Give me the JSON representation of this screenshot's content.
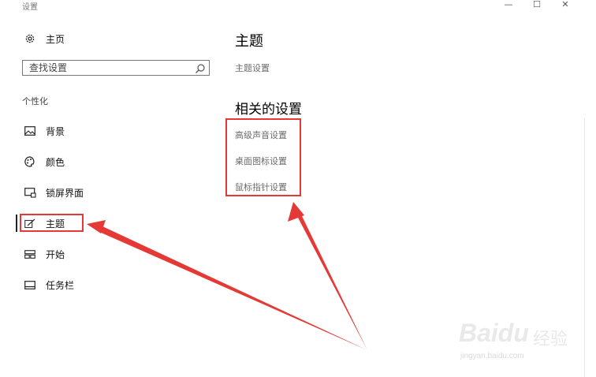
{
  "window": {
    "title": "设置",
    "minimize_glyph": "—",
    "maximize_glyph": "☐",
    "close_glyph": "✕"
  },
  "sidebar": {
    "home": {
      "label": "主页",
      "icon": "gear-icon"
    },
    "search": {
      "placeholder": "查找设置",
      "icon": "search-icon"
    },
    "section_label": "个性化",
    "items": [
      {
        "label": "背景",
        "icon": "picture-icon"
      },
      {
        "label": "颜色",
        "icon": "palette-icon"
      },
      {
        "label": "锁屏界面",
        "icon": "lockscreen-icon"
      },
      {
        "label": "主题",
        "icon": "brush-icon",
        "selected": true
      },
      {
        "label": "开始",
        "icon": "start-icon"
      },
      {
        "label": "任务栏",
        "icon": "taskbar-icon"
      }
    ]
  },
  "main": {
    "title": "主题",
    "theme_settings_link": "主题设置",
    "related_title": "相关的设置",
    "related_links": [
      "高级声音设置",
      "桌面图标设置",
      "鼠标指针设置"
    ]
  },
  "annotation": {
    "color": "#e53935"
  },
  "watermark": {
    "brand": "Baidu",
    "cn": "经验",
    "url": "jingyan.baidu.com"
  }
}
